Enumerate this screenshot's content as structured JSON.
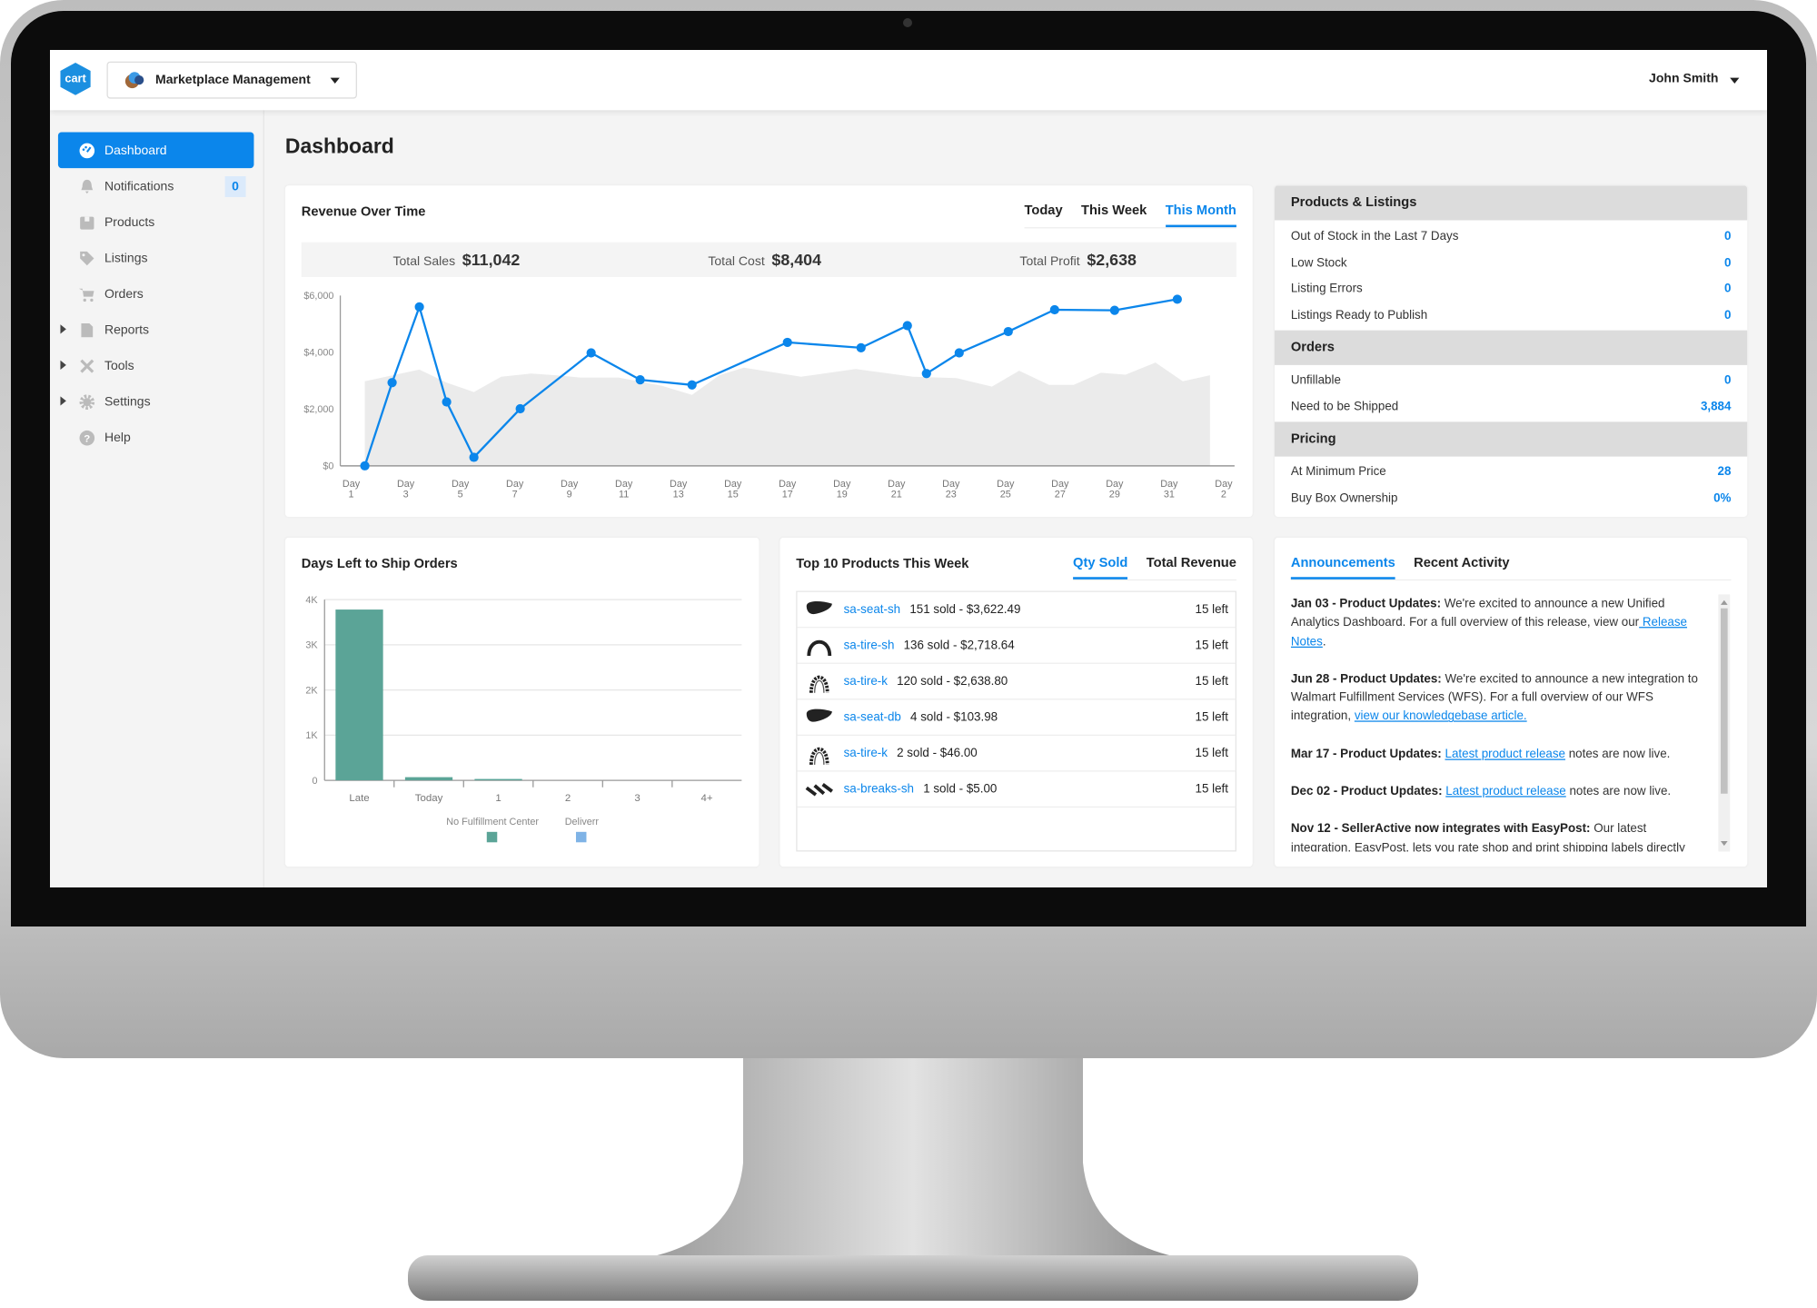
{
  "header": {
    "logo_text": "cart.com",
    "marketplace_selector": "Marketplace Management",
    "user_name": "John Smith"
  },
  "sidebar": {
    "items": [
      {
        "label": "Dashboard",
        "icon": "dashboard-icon",
        "active": true
      },
      {
        "label": "Notifications",
        "icon": "bell-icon",
        "badge": "0"
      },
      {
        "label": "Products",
        "icon": "box-icon"
      },
      {
        "label": "Listings",
        "icon": "tag-icon"
      },
      {
        "label": "Orders",
        "icon": "cart-icon"
      },
      {
        "label": "Reports",
        "icon": "report-icon",
        "expandable": true
      },
      {
        "label": "Tools",
        "icon": "tools-icon",
        "expandable": true
      },
      {
        "label": "Settings",
        "icon": "gear-icon",
        "expandable": true
      },
      {
        "label": "Help",
        "icon": "help-icon"
      }
    ]
  },
  "page_title": "Dashboard",
  "colors": {
    "accent": "#0b86eb",
    "area": "#ebebeb",
    "bar_primary": "#5ba497",
    "bar_secondary": "#7fb3e6"
  },
  "revenue": {
    "title": "Revenue Over Time",
    "tabs": [
      "Today",
      "This Week",
      "This Month"
    ],
    "active_tab": "This Month",
    "totals": [
      {
        "label": "Total Sales",
        "value": "$11,042"
      },
      {
        "label": "Total Cost",
        "value": "$8,404"
      },
      {
        "label": "Total Profit",
        "value": "$2,638"
      }
    ]
  },
  "products_listings": {
    "sections": [
      {
        "title": "Products & Listings",
        "rows": [
          {
            "label": "Out of Stock in the Last 7 Days",
            "value": "0"
          },
          {
            "label": "Low Stock",
            "value": "0"
          },
          {
            "label": "Listing Errors",
            "value": "0"
          },
          {
            "label": "Listings Ready to Publish",
            "value": "0"
          }
        ]
      },
      {
        "title": "Orders",
        "rows": [
          {
            "label": "Unfillable",
            "value": "0"
          },
          {
            "label": "Need to be Shipped",
            "value": "3,884"
          }
        ]
      },
      {
        "title": "Pricing",
        "rows": [
          {
            "label": "At Minimum Price",
            "value": "28"
          },
          {
            "label": "Buy Box Ownership",
            "value": "0%"
          }
        ]
      }
    ]
  },
  "top_products": {
    "title": "Top 10 Products This Week",
    "tabs": [
      "Qty Sold",
      "Total Revenue"
    ],
    "active_tab": "Qty Sold",
    "items": [
      {
        "sku": "sa-seat-sh",
        "stats": "151 sold - $3,622.49",
        "stock": "15 left",
        "thumb": "seat"
      },
      {
        "sku": "sa-tire-sh",
        "stats": "136 sold - $2,718.64",
        "stock": "15 left",
        "thumb": "tire"
      },
      {
        "sku": "sa-tire-k",
        "stats": "120 sold - $2,638.80",
        "stock": "15 left",
        "thumb": "tire-knobby"
      },
      {
        "sku": "sa-seat-db",
        "stats": "4 sold - $103.98",
        "stock": "15 left",
        "thumb": "seat"
      },
      {
        "sku": "sa-tire-k",
        "stats": "2 sold - $46.00",
        "stock": "15 left",
        "thumb": "tire-knobby"
      },
      {
        "sku": "sa-breaks-sh",
        "stats": "1 sold - $5.00",
        "stock": "15 left",
        "thumb": "brakes"
      }
    ]
  },
  "announcements": {
    "tabs": [
      "Announcements",
      "Recent Activity"
    ],
    "active_tab": "Announcements",
    "items": [
      {
        "heading": "Jan 03 - Product Updates:",
        "text": " We're excited to announce a new Unified Analytics Dashboard. For a full overview of this release, view our",
        "link": " Release Notes",
        "after": "."
      },
      {
        "heading": "Jun 28 - Product Updates:",
        "text": " We're excited to announce a new integration to Walmart Fulfillment Services (WFS). For a full overview of our WFS integration, ",
        "link": "view our knowledgebase article. ",
        "after": ""
      },
      {
        "heading": "Mar 17 - Product Updates:",
        "text": " ",
        "link": "Latest product release",
        "after": " notes are now live."
      },
      {
        "heading": "Dec 02 - Product Updates:",
        "text": " ",
        "link": "Latest product release",
        "after": " notes are now live."
      },
      {
        "heading": "Nov 12 - SellerActive now integrates with EasyPost:",
        "text": " Our latest integration, EasyPost, lets you rate shop and print shipping labels directly from the",
        "link": "",
        "after": ""
      }
    ]
  },
  "chart_data": [
    {
      "type": "line",
      "title": "Revenue Over Time",
      "x_tick_labels": [
        "Day 1",
        "Day 3",
        "Day 5",
        "Day 7",
        "Day 9",
        "Day 11",
        "Day 13",
        "Day 15",
        "Day 17",
        "Day 19",
        "Day 21",
        "Day 23",
        "Day 25",
        "Day 27",
        "Day 29",
        "Day 31",
        "Day 2"
      ],
      "x_tick_positions": [
        1,
        3,
        5,
        7,
        9,
        11,
        13,
        15,
        17,
        19,
        21,
        23,
        25,
        27,
        29,
        31,
        33
      ],
      "xlim": [
        0.6,
        33.4
      ],
      "y_tick_labels": [
        "$0",
        "$2,000",
        "$4,000",
        "$6,000"
      ],
      "ylim": [
        0,
        6000
      ],
      "grid": false,
      "series": [
        {
          "kind": "line",
          "color": "#0b86eb",
          "points": [
            [
              1.5,
              0
            ],
            [
              2.5,
              2930
            ],
            [
              3.5,
              5600
            ],
            [
              4.5,
              2250
            ],
            [
              5.5,
              300
            ],
            [
              7.2,
              2010
            ],
            [
              9.8,
              3980
            ],
            [
              11.6,
              3030
            ],
            [
              13.5,
              2850
            ],
            [
              17,
              4350
            ],
            [
              19.7,
              4160
            ],
            [
              21.4,
              4940
            ],
            [
              22.1,
              3250
            ],
            [
              23.3,
              3980
            ],
            [
              25.1,
              4730
            ],
            [
              26.8,
              5500
            ],
            [
              29,
              5480
            ],
            [
              31.3,
              5870
            ]
          ]
        },
        {
          "kind": "area",
          "color": "#ebebeb",
          "points": [
            [
              1.5,
              2980
            ],
            [
              3.5,
              3390
            ],
            [
              4.5,
              2930
            ],
            [
              5.5,
              2600
            ],
            [
              6.5,
              3140
            ],
            [
              7.6,
              3250
            ],
            [
              8.5,
              3190
            ],
            [
              9.4,
              3110
            ],
            [
              10.8,
              3110
            ],
            [
              12.4,
              2820
            ],
            [
              13.5,
              2500
            ],
            [
              14.5,
              3190
            ],
            [
              15.4,
              3460
            ],
            [
              17.5,
              3140
            ],
            [
              19.5,
              3410
            ],
            [
              21.6,
              3140
            ],
            [
              23.2,
              3090
            ],
            [
              24.5,
              2790
            ],
            [
              25.5,
              3350
            ],
            [
              26.6,
              2850
            ],
            [
              27.5,
              2850
            ],
            [
              28.5,
              3280
            ],
            [
              29.4,
              3210
            ],
            [
              30.5,
              3640
            ],
            [
              31.5,
              2980
            ],
            [
              32.5,
              3190
            ]
          ]
        }
      ]
    },
    {
      "type": "bar",
      "title": "Days Left to Ship Orders",
      "categories": [
        "Late",
        "Today",
        "1",
        "2",
        "3",
        "4+"
      ],
      "y_tick_labels": [
        "0",
        "1K",
        "2K",
        "3K",
        "4K"
      ],
      "ylim": [
        0,
        4000
      ],
      "grid": true,
      "legend": "bottom",
      "series": [
        {
          "name": "No Fulfillment Center",
          "color": "#5ba497",
          "values": [
            3780,
            70,
            30,
            0,
            0,
            0
          ]
        },
        {
          "name": "Deliverr",
          "color": "#7fb3e6",
          "values": [
            0,
            0,
            0,
            0,
            0,
            0
          ]
        }
      ]
    }
  ]
}
